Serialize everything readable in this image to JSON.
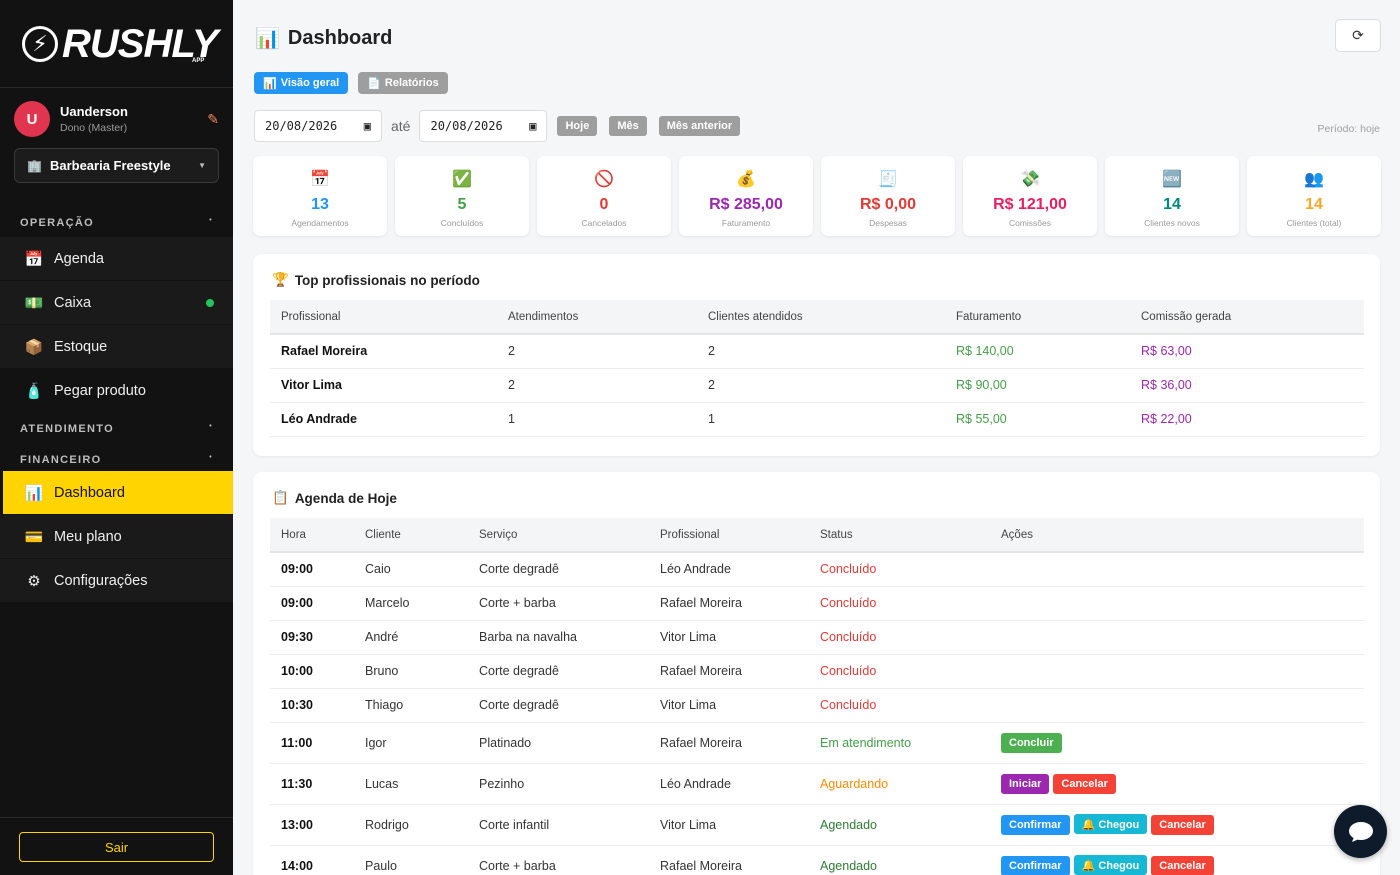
{
  "brand": {
    "name": "RUSHLY",
    "sub": "APP"
  },
  "user": {
    "initial": "U",
    "name": "Uanderson",
    "role": "Dono (Master)"
  },
  "shop": {
    "name": "Barbearia Freestyle"
  },
  "sidebar": {
    "section_operacao": "OPERAÇÃO",
    "section_atendimento": "ATENDIMENTO",
    "section_financeiro": "FINANCEIRO",
    "items": [
      {
        "label": "Agenda",
        "icon": "📅"
      },
      {
        "label": "Caixa",
        "icon": "💵"
      },
      {
        "label": "Estoque",
        "icon": "📦"
      },
      {
        "label": "Pegar produto",
        "icon": "🧴"
      },
      {
        "label": "Dashboard",
        "icon": "📊"
      },
      {
        "label": "Meu plano",
        "icon": "💳"
      },
      {
        "label": "Configurações",
        "icon": "⚙"
      }
    ],
    "logout": "Sair"
  },
  "header": {
    "title": "Dashboard",
    "title_icon": "📊",
    "refresh_icon": "⟳"
  },
  "tabs": [
    {
      "label": "Visão geral",
      "icon": "📊"
    },
    {
      "label": "Relatórios",
      "icon": "📄"
    }
  ],
  "filters": {
    "from": "20/08/2026",
    "to": "20/08/2026",
    "separator": "até",
    "buttons": [
      "Hoje",
      "Mês",
      "Mês anterior"
    ],
    "period": "Período: hoje"
  },
  "stats": [
    {
      "icon": "📅",
      "value": "13",
      "label": "Agendamentos",
      "color": "#2196f3"
    },
    {
      "icon": "✅",
      "value": "5",
      "label": "Concluídos",
      "color": "#43a047"
    },
    {
      "icon": "🚫",
      "value": "0",
      "label": "Cancelados",
      "color": "#e53935"
    },
    {
      "icon": "💰",
      "value": "R$ 285,00",
      "label": "Faturamento",
      "color": "#9c27b0"
    },
    {
      "icon": "🧾",
      "value": "R$ 0,00",
      "label": "Despesas",
      "color": "#e53935"
    },
    {
      "icon": "💸",
      "value": "R$ 121,00",
      "label": "Comissões",
      "color": "#e91e63"
    },
    {
      "icon": "🆕",
      "value": "14",
      "label": "Clientes novos",
      "color": "#00897b"
    },
    {
      "icon": "👥",
      "value": "14",
      "label": "Clientes (total)",
      "color": "#f9a825"
    }
  ],
  "top": {
    "title": "Top profissionais no período",
    "icon": "🏆",
    "columns": [
      "Profissional",
      "Atendimentos",
      "Clientes atendidos",
      "Faturamento",
      "Comissão gerada"
    ],
    "rows": [
      [
        "Rafael Moreira",
        "2",
        "2",
        "R$ 140,00",
        "R$ 63,00"
      ],
      [
        "Vitor Lima",
        "2",
        "2",
        "R$ 90,00",
        "R$ 36,00"
      ],
      [
        "Léo Andrade",
        "1",
        "1",
        "R$ 55,00",
        "R$ 22,00"
      ]
    ]
  },
  "agenda": {
    "title": "Agenda de Hoje",
    "icon": "📋",
    "columns": [
      "Hora",
      "Cliente",
      "Serviço",
      "Profissional",
      "Status",
      "Ações"
    ],
    "rows": [
      {
        "hora": "09:00",
        "cliente": "Caio",
        "servico": "Corte degradê",
        "prof": "Léo Andrade",
        "status": "Concluído",
        "status_class": "red",
        "actions": []
      },
      {
        "hora": "09:00",
        "cliente": "Marcelo",
        "servico": "Corte + barba",
        "prof": "Rafael Moreira",
        "status": "Concluído",
        "status_class": "red",
        "actions": []
      },
      {
        "hora": "09:30",
        "cliente": "André",
        "servico": "Barba na navalha",
        "prof": "Vitor Lima",
        "status": "Concluído",
        "status_class": "red",
        "actions": []
      },
      {
        "hora": "10:00",
        "cliente": "Bruno",
        "servico": "Corte degradê",
        "prof": "Rafael Moreira",
        "status": "Concluído",
        "status_class": "red",
        "actions": []
      },
      {
        "hora": "10:30",
        "cliente": "Thiago",
        "servico": "Corte degradê",
        "prof": "Vitor Lima",
        "status": "Concluído",
        "status_class": "red",
        "actions": []
      },
      {
        "hora": "11:00",
        "cliente": "Igor",
        "servico": "Platinado",
        "prof": "Rafael Moreira",
        "status": "Em atendimento",
        "status_class": "green",
        "actions": [
          {
            "label": "Concluir",
            "cls": "a-green"
          }
        ]
      },
      {
        "hora": "11:30",
        "cliente": "Lucas",
        "servico": "Pezinho",
        "prof": "Léo Andrade",
        "status": "Aguardando",
        "status_class": "orange",
        "actions": [
          {
            "label": "Iniciar",
            "cls": "a-purple"
          },
          {
            "label": "Cancelar",
            "cls": "a-red"
          }
        ]
      },
      {
        "hora": "13:00",
        "cliente": "Rodrigo",
        "servico": "Corte infantil",
        "prof": "Vitor Lima",
        "status": "Agendado",
        "status_class": "dgreen",
        "actions": [
          {
            "label": "Confirmar",
            "cls": "a-blue"
          },
          {
            "label": "🔔 Chegou",
            "cls": "a-cyan"
          },
          {
            "label": "Cancelar",
            "cls": "a-red"
          }
        ]
      },
      {
        "hora": "14:00",
        "cliente": "Paulo",
        "servico": "Corte + barba",
        "prof": "Rafael Moreira",
        "status": "Agendado",
        "status_class": "dgreen",
        "actions": [
          {
            "label": "Confirmar",
            "cls": "a-blue"
          },
          {
            "label": "🔔 Chegou",
            "cls": "a-cyan"
          },
          {
            "label": "Cancelar",
            "cls": "a-red"
          }
        ]
      }
    ]
  },
  "chat": {
    "icon": "💬"
  }
}
